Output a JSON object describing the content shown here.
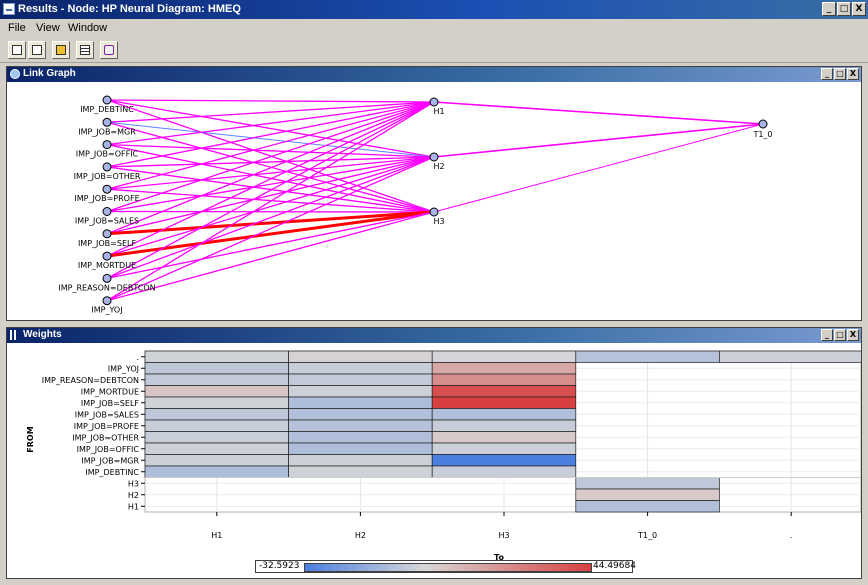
{
  "window": {
    "title": "Results - Node: HP Neural  Diagram: HMEQ",
    "buttons": {
      "minimize": "_",
      "restore": "□",
      "close": "X"
    }
  },
  "menu": [
    "File",
    "View",
    "Window"
  ],
  "toolbar": {
    "icons": [
      "copy-icon",
      "properties-icon",
      "print-icon",
      "table-icon",
      "wand-icon"
    ]
  },
  "link_graph": {
    "title": "Link Graph",
    "inputs": [
      "IMP_DEBTINC",
      "IMP_JOB=MGR",
      "IMP_JOB=OFFIC",
      "IMP_JOB=OTHER",
      "IMP_JOB=PROFE",
      "IMP_JOB=SALES",
      "IMP_JOB=SELF",
      "IMP_MORTDUE",
      "IMP_REASON=DEBTCON",
      "IMP_YOJ"
    ],
    "hidden": [
      "H1",
      "H2",
      "H3"
    ],
    "output": "T1_0",
    "colors": {
      "positive": "#ff00ff",
      "strong": "#ff0000",
      "weak": "#6080ff",
      "node_fill": "#a8b4e8"
    },
    "strong_links": [
      [
        "IMP_JOB=SELF",
        "H3"
      ],
      [
        "IMP_MORTDUE",
        "H3"
      ]
    ],
    "weak_links": [
      [
        "IMP_JOB=MGR",
        "H2"
      ]
    ]
  },
  "weights": {
    "title": "Weights",
    "y_axis_label": "FROM",
    "x_axis_label": "To",
    "legend": {
      "min": "-32.5923",
      "max": "44.49684",
      "min_color": "#4b7fe0",
      "mid_color": "#d8d8d8",
      "max_color": "#d84040"
    },
    "chart_data": {
      "type": "heatmap",
      "x_categories": [
        "H1",
        "H2",
        "H3",
        "T1_0",
        "."
      ],
      "y_categories": [
        ".",
        "IMP_YOJ",
        "IMP_REASON=DEBTCON",
        "IMP_MORTDUE",
        "IMP_JOB=SELF",
        "IMP_JOB=SALES",
        "IMP_JOB=PROFE",
        "IMP_JOB=OTHER",
        "IMP_JOB=OFFIC",
        "IMP_JOB=MGR",
        "IMP_DEBTINC",
        "H3",
        "H2",
        "H1"
      ],
      "cells": [
        [
          ".",
          "H1",
          -2
        ],
        [
          ".",
          "H2",
          2
        ],
        [
          ".",
          "H3",
          -1
        ],
        [
          ".",
          "T1_0",
          -8
        ],
        [
          ".",
          ".",
          -3
        ],
        [
          "IMP_YOJ",
          "H1",
          -6
        ],
        [
          "IMP_YOJ",
          "H2",
          -4
        ],
        [
          "IMP_YOJ",
          "H3",
          14
        ],
        [
          "IMP_REASON=DEBTCON",
          "H1",
          -5
        ],
        [
          "IMP_REASON=DEBTCON",
          "H2",
          -5
        ],
        [
          "IMP_REASON=DEBTCON",
          "H3",
          22
        ],
        [
          "IMP_MORTDUE",
          "H1",
          6
        ],
        [
          "IMP_MORTDUE",
          "H2",
          -3
        ],
        [
          "IMP_MORTDUE",
          "H3",
          40
        ],
        [
          "IMP_JOB=SELF",
          "H1",
          -2
        ],
        [
          "IMP_JOB=SELF",
          "H2",
          -10
        ],
        [
          "IMP_JOB=SELF",
          "H3",
          44.49684
        ],
        [
          "IMP_JOB=SALES",
          "H1",
          -6
        ],
        [
          "IMP_JOB=SALES",
          "H2",
          -9
        ],
        [
          "IMP_JOB=SALES",
          "H3",
          -9
        ],
        [
          "IMP_JOB=PROFE",
          "H1",
          -4
        ],
        [
          "IMP_JOB=PROFE",
          "H2",
          -8
        ],
        [
          "IMP_JOB=PROFE",
          "H3",
          -4
        ],
        [
          "IMP_JOB=OTHER",
          "H1",
          -4
        ],
        [
          "IMP_JOB=OTHER",
          "H2",
          -9
        ],
        [
          "IMP_JOB=OTHER",
          "H3",
          4
        ],
        [
          "IMP_JOB=OFFIC",
          "H1",
          -3
        ],
        [
          "IMP_JOB=OFFIC",
          "H2",
          -10
        ],
        [
          "IMP_JOB=OFFIC",
          "H3",
          -3
        ],
        [
          "IMP_JOB=MGR",
          "H1",
          -3
        ],
        [
          "IMP_JOB=MGR",
          "H2",
          -3
        ],
        [
          "IMP_JOB=MGR",
          "H3",
          -32.5923
        ],
        [
          "IMP_DEBTINC",
          "H1",
          -10
        ],
        [
          "IMP_DEBTINC",
          "H2",
          -2
        ],
        [
          "IMP_DEBTINC",
          "H3",
          -4
        ],
        [
          "H3",
          "T1_0",
          -6
        ],
        [
          "H2",
          "T1_0",
          4
        ],
        [
          "H1",
          "T1_0",
          -9
        ]
      ],
      "value_range": [
        -32.5923,
        44.49684
      ]
    }
  }
}
